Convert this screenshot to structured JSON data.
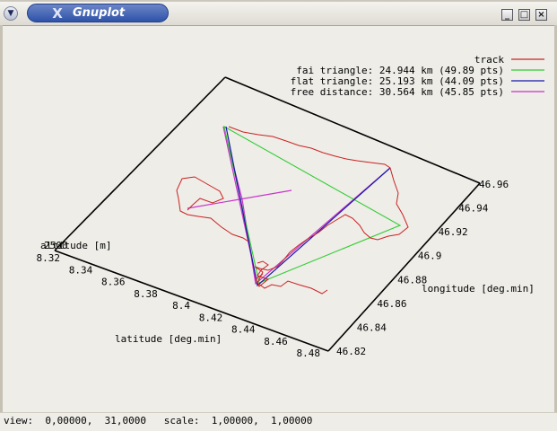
{
  "window": {
    "title": "Gnuplot",
    "app_icon": "x-icon",
    "buttons": {
      "minimize": "_",
      "maximize": "□",
      "close": "×"
    }
  },
  "legend": [
    {
      "label": "track",
      "color": "#cc2222"
    },
    {
      "label": "fai triangle: 24.944 km (49.89 pts)",
      "color": "#33cc33"
    },
    {
      "label": "flat triangle: 25.193 km (44.09 pts)",
      "color": "#1a1aa6"
    },
    {
      "label": "free distance: 30.564 km (45.85 pts)",
      "color": "#cc33cc"
    }
  ],
  "axes": {
    "altitude_label": "altitude [m]",
    "altitude_tick": "2500",
    "latitude_label": "latitude [deg.min]",
    "longitude_label": "longitude [deg.min]",
    "latitude_ticks": [
      "8.32",
      "8.34",
      "8.36",
      "8.38",
      "8.4",
      "8.42",
      "8.44",
      "8.46",
      "8.48"
    ],
    "longitude_ticks": [
      "46.82",
      "46.84",
      "46.86",
      "46.88",
      "46.9",
      "46.92",
      "46.94",
      "46.96"
    ]
  },
  "status": {
    "text": "view:  0,00000,  31,0000   scale:  1,00000,  1,00000"
  }
}
